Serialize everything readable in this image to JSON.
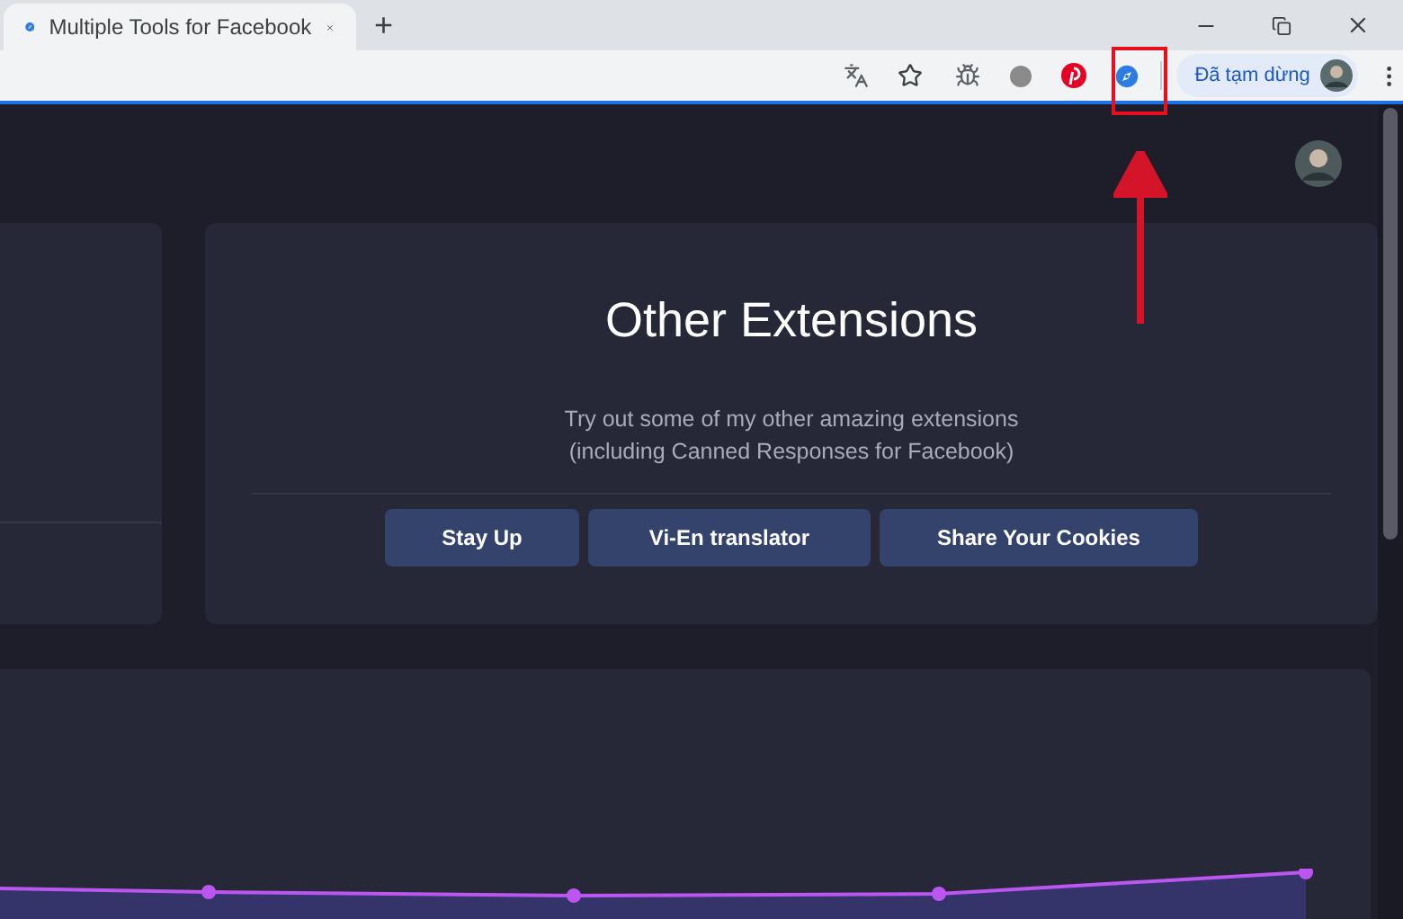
{
  "browser": {
    "tab": {
      "title": "Multiple Tools for Facebook",
      "selected": true
    },
    "new_tab": "+",
    "profile": {
      "status": "Đã tạm dừng"
    }
  },
  "extensions_card": {
    "title": "Other Extensions",
    "description": [
      "Try out some of my other amazing extensions",
      "(including Canned Responses for Facebook)"
    ],
    "buttons": [
      "Stay Up",
      "Vi-En translator",
      "Share Your Cookies"
    ]
  }
}
